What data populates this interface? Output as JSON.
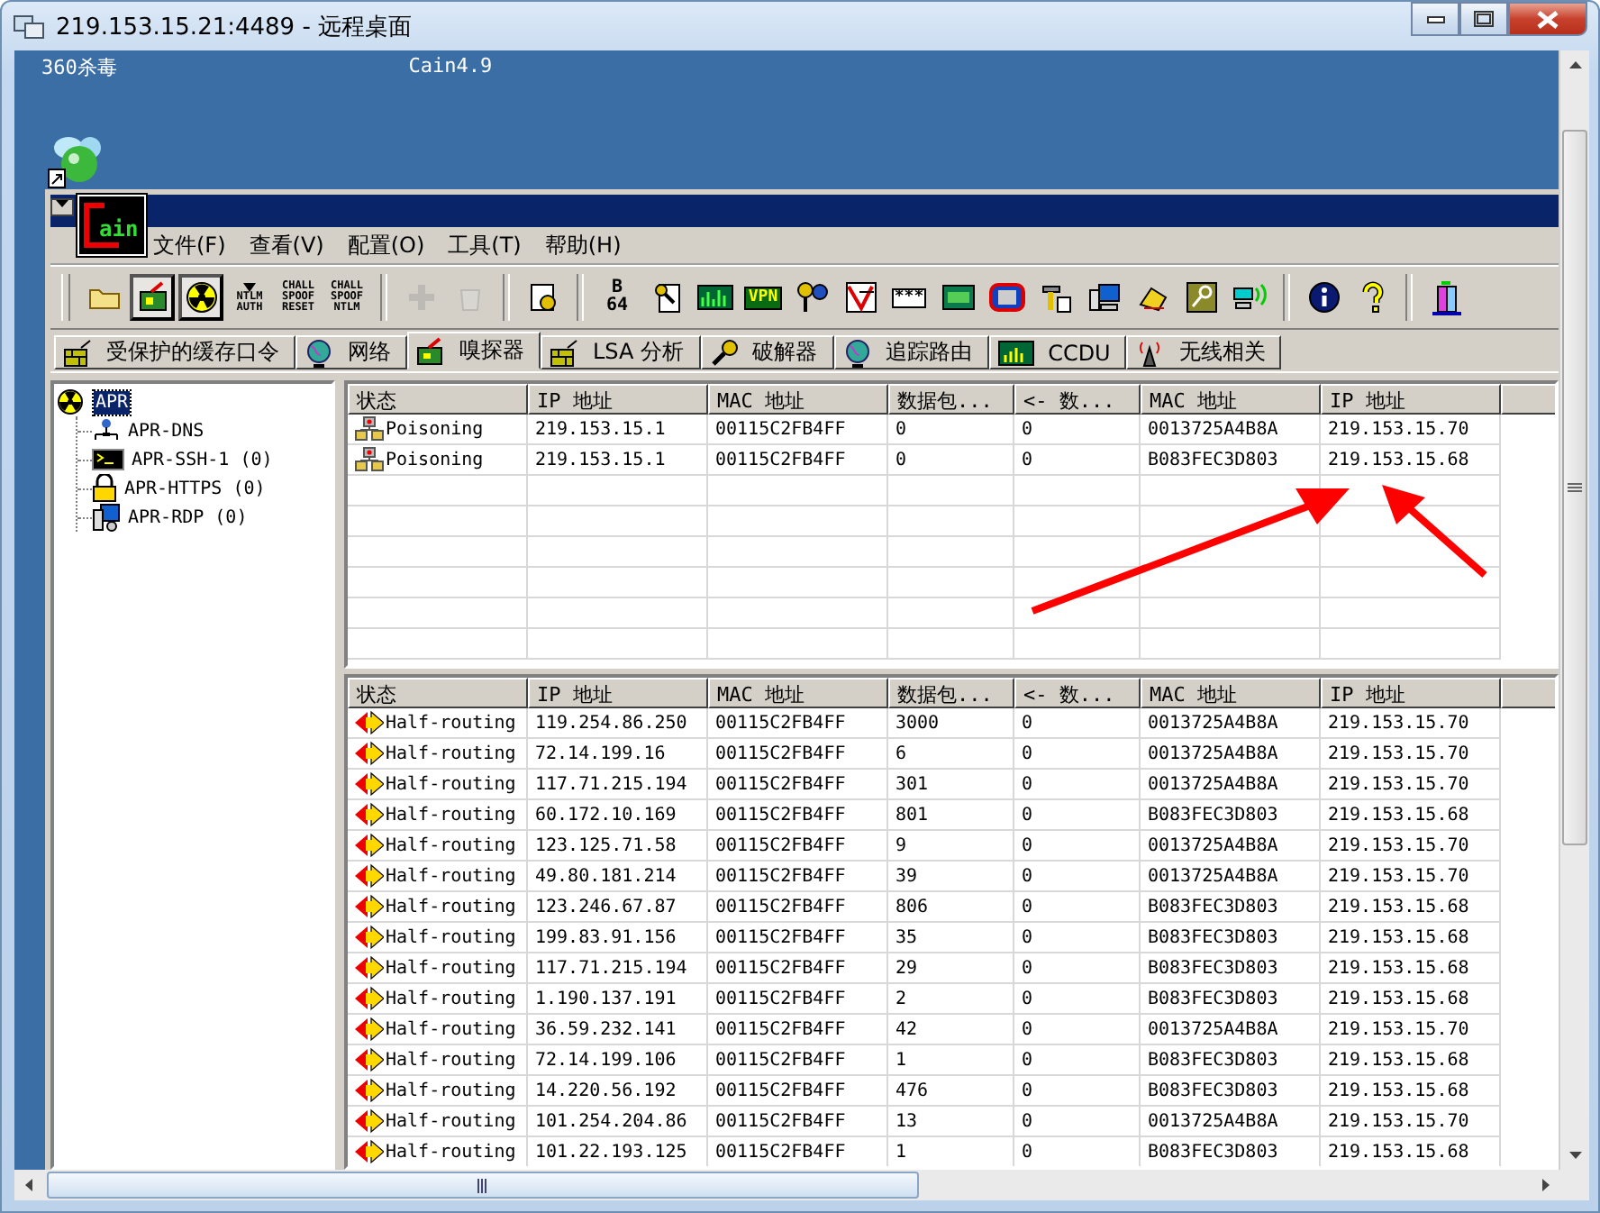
{
  "window": {
    "title": "219.153.15.21:4489 - 远程桌面"
  },
  "desktop": {
    "labels": [
      "360杀毒",
      "Cain4.9"
    ]
  },
  "cain": {
    "menu": [
      "文件(F)",
      "查看(V)",
      "配置(O)",
      "工具(T)",
      "帮助(H)"
    ],
    "logo": "ain",
    "toolbar": [
      {
        "kind": "folder",
        "pressed": false,
        "disabled": false
      },
      {
        "kind": "nic",
        "pressed": true,
        "disabled": false
      },
      {
        "kind": "radiation",
        "pressed": true,
        "disabled": false
      },
      {
        "kind": "text",
        "lines": [
          "NTLM",
          "AUTH"
        ],
        "pressed": false,
        "disabled": false
      },
      {
        "kind": "text",
        "lines": [
          "CHALL",
          "SPOOF",
          "RESET"
        ],
        "pressed": false,
        "disabled": false
      },
      {
        "kind": "text",
        "lines": [
          "CHALL",
          "SPOOF",
          "NTLM"
        ],
        "pressed": false,
        "disabled": false
      },
      {
        "kind": "separator"
      },
      {
        "kind": "plus",
        "pressed": false,
        "disabled": true
      },
      {
        "kind": "recycle",
        "pressed": false,
        "disabled": true
      },
      {
        "kind": "separator"
      },
      {
        "kind": "certificate",
        "pressed": false,
        "disabled": false
      },
      {
        "kind": "separator"
      },
      {
        "kind": "b64",
        "lines": [
          "B",
          "64"
        ],
        "pressed": false,
        "disabled": false
      },
      {
        "kind": "keydoc",
        "pressed": false,
        "disabled": false
      },
      {
        "kind": "meter",
        "pressed": false,
        "disabled": false
      },
      {
        "kind": "badge",
        "lines": [
          "VPN"
        ],
        "pressed": false,
        "disabled": false
      },
      {
        "kind": "keyglobe",
        "pressed": false,
        "disabled": false
      },
      {
        "kind": "chart",
        "pressed": false,
        "disabled": false
      },
      {
        "kind": "password",
        "lines": [
          "***"
        ],
        "pressed": false,
        "disabled": false
      },
      {
        "kind": "card",
        "pressed": false,
        "disabled": false
      },
      {
        "kind": "screen",
        "pressed": false,
        "disabled": false
      },
      {
        "kind": "hammer",
        "pressed": false,
        "disabled": false
      },
      {
        "kind": "computer",
        "pressed": false,
        "disabled": false
      },
      {
        "kind": "phone",
        "pressed": false,
        "disabled": false
      },
      {
        "kind": "key",
        "pressed": false,
        "disabled": false
      },
      {
        "kind": "wireless",
        "pressed": false,
        "disabled": false
      },
      {
        "kind": "separator"
      },
      {
        "kind": "info",
        "pressed": false,
        "disabled": false
      },
      {
        "kind": "help",
        "pressed": false,
        "disabled": false
      },
      {
        "kind": "separator"
      },
      {
        "kind": "tower",
        "pressed": false,
        "disabled": false
      }
    ],
    "tabs": [
      {
        "label": "受保护的缓存口令",
        "selected": false
      },
      {
        "label": "网络",
        "selected": false
      },
      {
        "label": "嗅探器",
        "selected": true
      },
      {
        "label": "LSA 分析",
        "selected": false
      },
      {
        "label": "破解器",
        "selected": false
      },
      {
        "label": "追踪路由",
        "selected": false
      },
      {
        "label": "CCDU",
        "selected": false
      },
      {
        "label": "无线相关",
        "selected": false
      }
    ],
    "tree": [
      {
        "label": "APR",
        "selected": true,
        "children": [
          {
            "label": "APR-DNS",
            "selected": false
          },
          {
            "label": "APR-SSH-1 (0)",
            "selected": false
          },
          {
            "label": "APR-HTTPS (0)",
            "selected": false
          },
          {
            "label": "APR-RDP (0)",
            "selected": false
          }
        ]
      }
    ],
    "upper_table": {
      "columns": [
        "状态",
        "IP 地址",
        "MAC 地址",
        "数据包...",
        "<- 数...",
        "MAC 地址",
        "IP 地址"
      ],
      "rows": [
        {
          "kind": "poisoning",
          "cells": [
            "Poisoning",
            "219.153.15.1",
            "00115C2FB4FF",
            "0",
            "0",
            "0013725A4B8A",
            "219.153.15.70"
          ]
        },
        {
          "kind": "poisoning",
          "cells": [
            "Poisoning",
            "219.153.15.1",
            "00115C2FB4FF",
            "0",
            "0",
            "B083FEC3D803",
            "219.153.15.68"
          ]
        }
      ]
    },
    "lower_table": {
      "columns": [
        "状态",
        "IP 地址",
        "MAC 地址",
        "数据包...",
        "<- 数...",
        "MAC 地址",
        "IP 地址"
      ],
      "rows": [
        {
          "kind": "half_routing",
          "cells": [
            "Half-routing",
            "119.254.86.250",
            "00115C2FB4FF",
            "3000",
            "0",
            "0013725A4B8A",
            "219.153.15.70"
          ]
        },
        {
          "kind": "half_routing",
          "cells": [
            "Half-routing",
            "72.14.199.16",
            "00115C2FB4FF",
            "6",
            "0",
            "0013725A4B8A",
            "219.153.15.70"
          ]
        },
        {
          "kind": "half_routing",
          "cells": [
            "Half-routing",
            "117.71.215.194",
            "00115C2FB4FF",
            "301",
            "0",
            "0013725A4B8A",
            "219.153.15.70"
          ]
        },
        {
          "kind": "half_routing",
          "cells": [
            "Half-routing",
            "60.172.10.169",
            "00115C2FB4FF",
            "801",
            "0",
            "B083FEC3D803",
            "219.153.15.68"
          ]
        },
        {
          "kind": "half_routing",
          "cells": [
            "Half-routing",
            "123.125.71.58",
            "00115C2FB4FF",
            "9",
            "0",
            "0013725A4B8A",
            "219.153.15.70"
          ]
        },
        {
          "kind": "half_routing",
          "cells": [
            "Half-routing",
            "49.80.181.214",
            "00115C2FB4FF",
            "39",
            "0",
            "0013725A4B8A",
            "219.153.15.70"
          ]
        },
        {
          "kind": "half_routing",
          "cells": [
            "Half-routing",
            "123.246.67.87",
            "00115C2FB4FF",
            "806",
            "0",
            "B083FEC3D803",
            "219.153.15.68"
          ]
        },
        {
          "kind": "half_routing",
          "cells": [
            "Half-routing",
            "199.83.91.156",
            "00115C2FB4FF",
            "35",
            "0",
            "B083FEC3D803",
            "219.153.15.68"
          ]
        },
        {
          "kind": "half_routing",
          "cells": [
            "Half-routing",
            "117.71.215.194",
            "00115C2FB4FF",
            "29",
            "0",
            "B083FEC3D803",
            "219.153.15.68"
          ]
        },
        {
          "kind": "half_routing",
          "cells": [
            "Half-routing",
            "1.190.137.191",
            "00115C2FB4FF",
            "2",
            "0",
            "B083FEC3D803",
            "219.153.15.68"
          ]
        },
        {
          "kind": "half_routing",
          "cells": [
            "Half-routing",
            "36.59.232.141",
            "00115C2FB4FF",
            "42",
            "0",
            "0013725A4B8A",
            "219.153.15.70"
          ]
        },
        {
          "kind": "half_routing",
          "cells": [
            "Half-routing",
            "72.14.199.106",
            "00115C2FB4FF",
            "1",
            "0",
            "B083FEC3D803",
            "219.153.15.68"
          ]
        },
        {
          "kind": "half_routing",
          "cells": [
            "Half-routing",
            "14.220.56.192",
            "00115C2FB4FF",
            "476",
            "0",
            "B083FEC3D803",
            "219.153.15.68"
          ]
        },
        {
          "kind": "half_routing",
          "cells": [
            "Half-routing",
            "101.254.204.86",
            "00115C2FB4FF",
            "13",
            "0",
            "0013725A4B8A",
            "219.153.15.70"
          ]
        },
        {
          "kind": "half_routing",
          "cells": [
            "Half-routing",
            "101.22.193.125",
            "00115C2FB4FF",
            "1",
            "0",
            "B083FEC3D803",
            "219.153.15.68"
          ]
        }
      ]
    }
  }
}
